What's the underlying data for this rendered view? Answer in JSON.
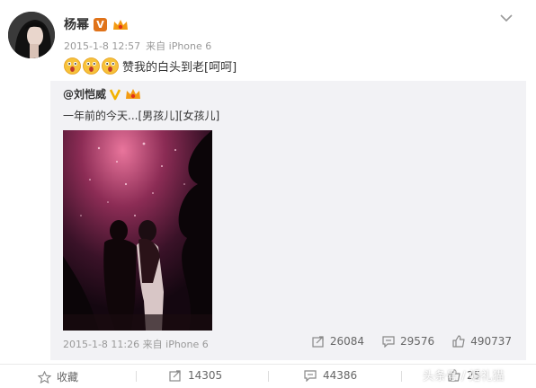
{
  "post": {
    "author": "杨幂",
    "date": "2015-1-8 12:57",
    "source": "来自 iPhone 6",
    "text": "赞我的白头到老[呵呵]",
    "emoji_count": 3
  },
  "repost": {
    "author": "@刘恺威",
    "text": "一年前的今天...[男孩儿][女孩儿]",
    "date": "2015-1-8 11:26",
    "source": "来自 iPhone 6",
    "stats": {
      "reposts": "26084",
      "comments": "29576",
      "likes": "490737"
    }
  },
  "footer": {
    "collect_label": "收藏",
    "reposts": "14305",
    "comments": "44386",
    "likes": "25"
  },
  "watermark": "头条号 / 婚礼猫",
  "colors": {
    "verified_orange": "#e0731a",
    "repost_bg": "#f2f2f5",
    "meta_gray": "#999999"
  }
}
